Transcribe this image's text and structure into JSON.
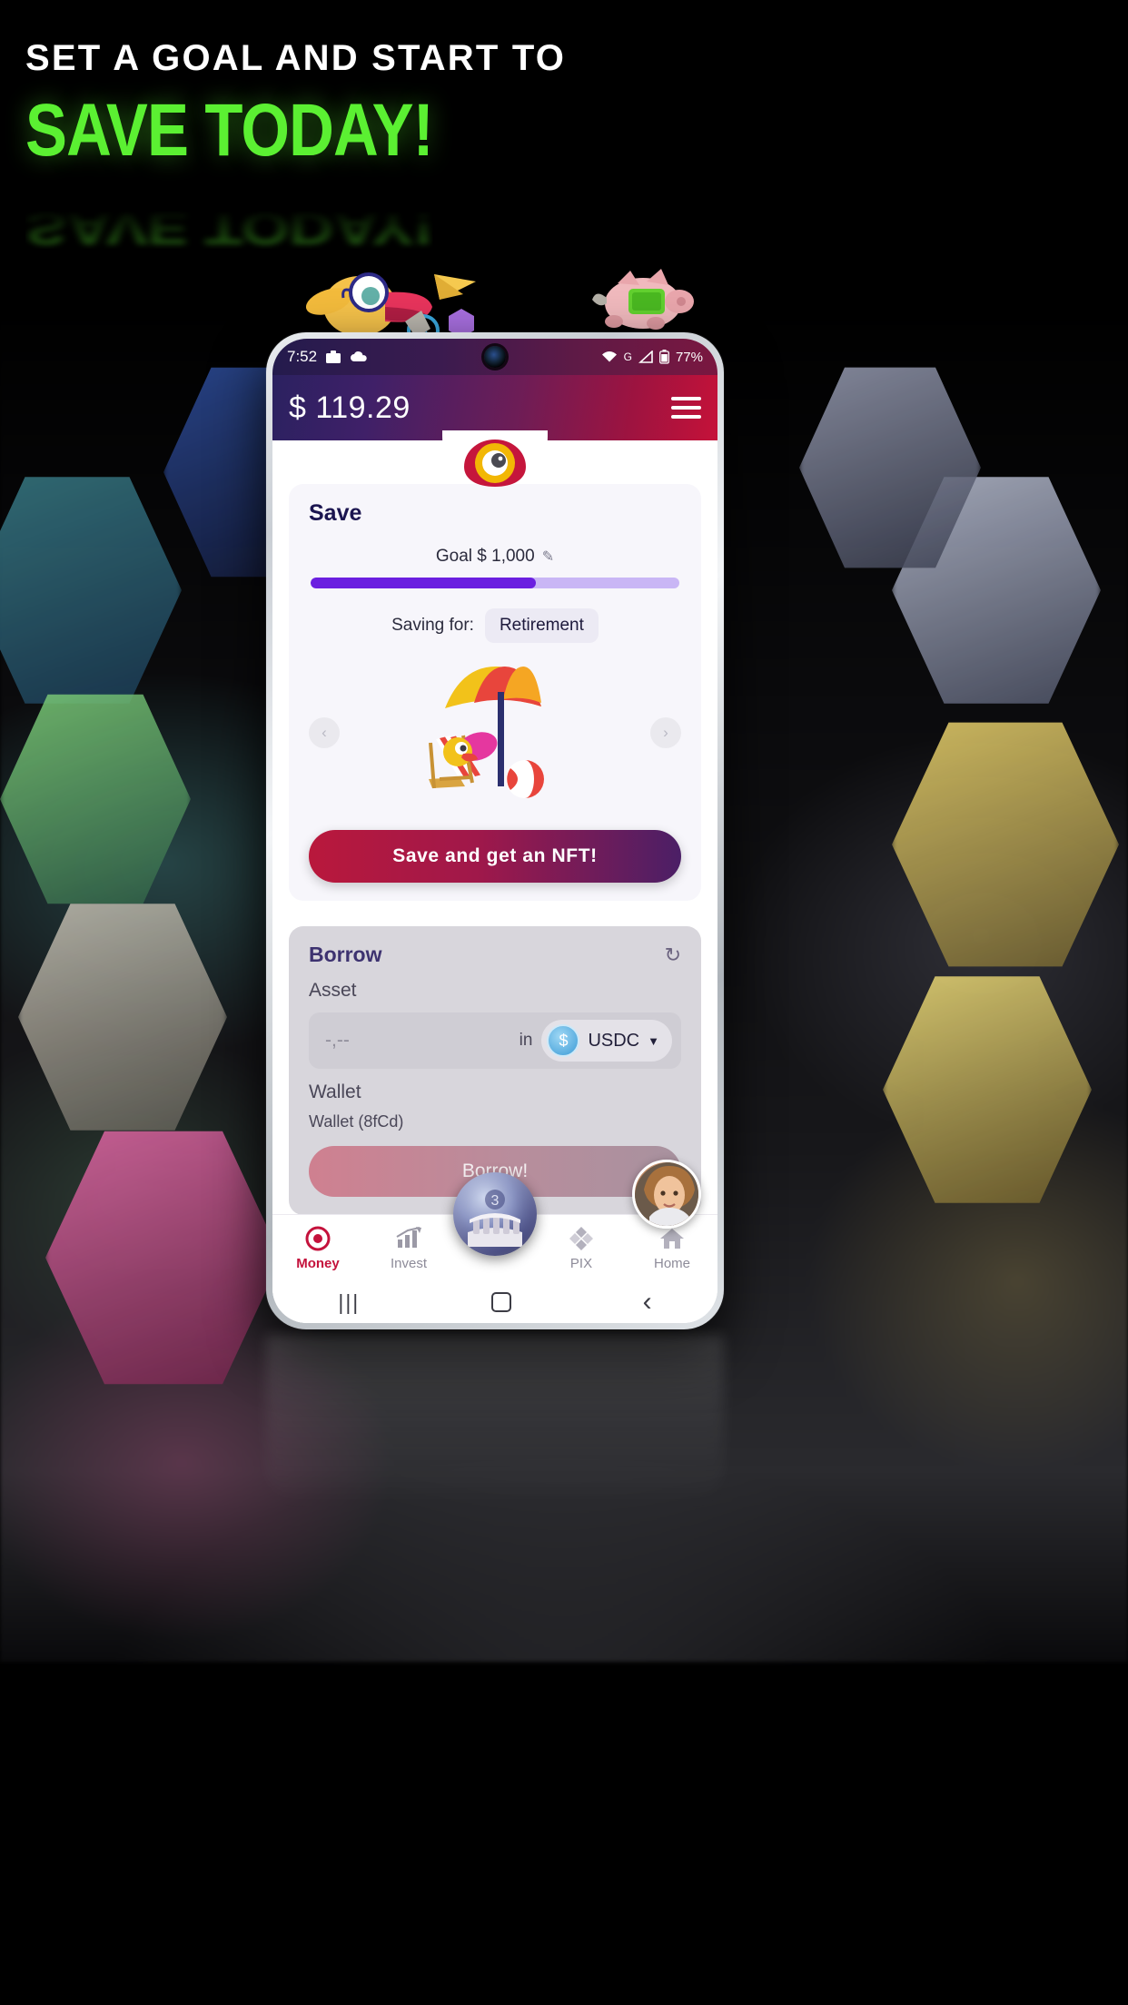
{
  "poster": {
    "headline_line1": "SET A GOAL AND START TO",
    "headline_line2": "SAVE TODAY!",
    "accent_green": "#5bf032",
    "background": "#000000"
  },
  "phone": {
    "statusbar": {
      "time": "7:52",
      "icons_left": [
        "briefcase-icon",
        "cloud-icon"
      ],
      "icons_right": [
        "wifi-icon",
        "network-g-label",
        "signal-icon",
        "battery-icon"
      ],
      "network_label": "G",
      "battery_percent": "77%"
    },
    "appbar": {
      "balance": "$ 119.29",
      "menu_icon": "hamburger-menu-icon",
      "gradient_from": "#2b2160",
      "gradient_to": "#c51239"
    },
    "save_card": {
      "title": "Save",
      "goal_label": "Goal $ 1,000",
      "edit_icon": "pencil-icon",
      "progress_percent": 61,
      "progress_fill_color": "#6b1fe0",
      "progress_track_color": "#c9b6f5",
      "saving_for_label": "Saving for:",
      "saving_for_value": "Retirement",
      "carousel_prev": "‹",
      "carousel_next": "›",
      "illustration": "beach-umbrella-deckchair-3d",
      "cta_label": "Save and get an NFT!"
    },
    "borrow_card": {
      "title": "Borrow",
      "refresh_icon": "refresh-icon",
      "asset_label": "Asset",
      "amount_placeholder": "-,--",
      "in_word": "in",
      "token_symbol": "USDC",
      "token_icon": "usdc-coin-icon",
      "token_caret": "▼",
      "wallet_label": "Wallet",
      "wallet_value": "Wallet (8fCd)",
      "cta_label": "Borrow!"
    },
    "avatar": {
      "name": "user-avatar"
    },
    "tabbar": {
      "items": [
        {
          "label": "Money",
          "icon": "money-dot-icon",
          "active": true
        },
        {
          "label": "Invest",
          "icon": "chart-up-icon",
          "active": false
        },
        {
          "label": "PIX",
          "icon": "pix-diamond-icon",
          "active": false
        },
        {
          "label": "Home",
          "icon": "home-icon",
          "active": false
        }
      ],
      "active_color": "#c4123c",
      "inactive_color": "#8d8b99",
      "center_button": "colosseum-orb-icon"
    },
    "navbar": {
      "recents": "|||",
      "home": "home-square-icon",
      "back": "‹"
    }
  }
}
